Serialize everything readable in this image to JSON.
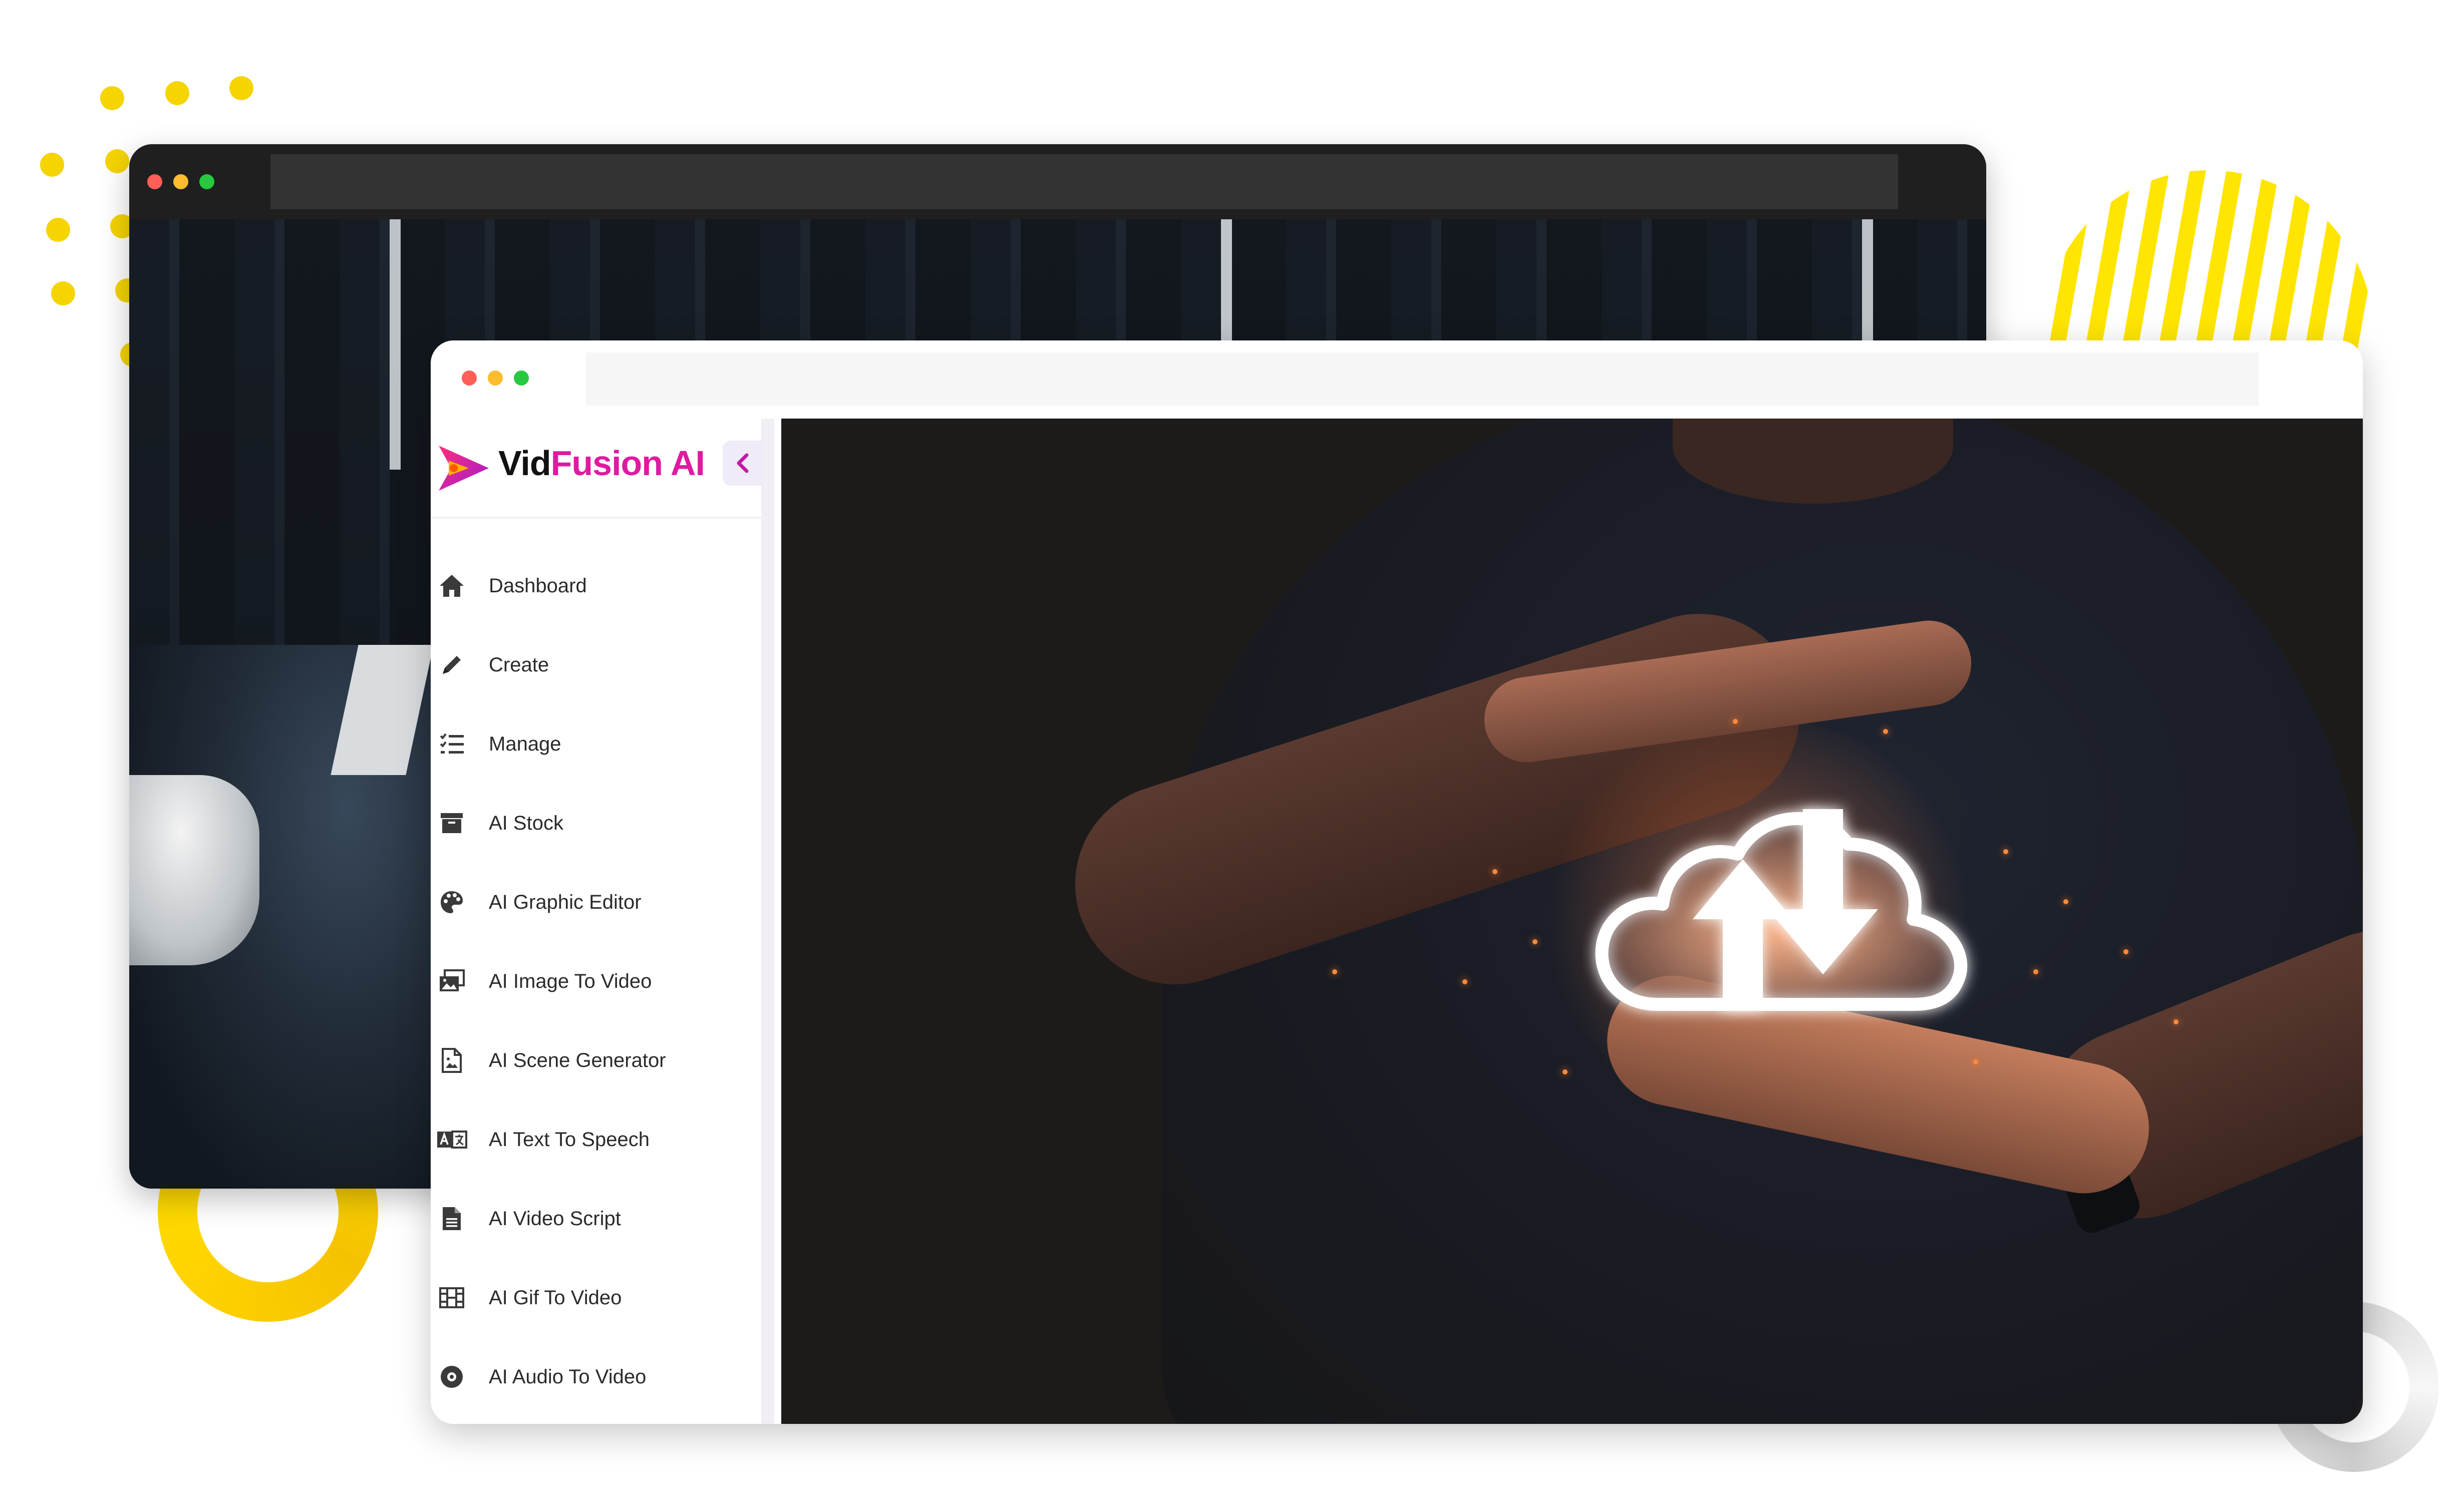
{
  "brand": {
    "part1": "Vid",
    "part2": "Fusion AI",
    "accent": "#e01aa0"
  },
  "sidebar": {
    "collapse_icon": "chevron-left-icon",
    "items": [
      {
        "label": "Dashboard",
        "icon": "home-icon"
      },
      {
        "label": "Create",
        "icon": "pencil-icon"
      },
      {
        "label": "Manage",
        "icon": "checklist-icon"
      },
      {
        "label": "AI Stock",
        "icon": "archive-icon"
      },
      {
        "label": "AI Graphic Editor",
        "icon": "palette-icon"
      },
      {
        "label": "AI Image To Video",
        "icon": "images-icon"
      },
      {
        "label": "AI Scene Generator",
        "icon": "file-image-icon"
      },
      {
        "label": "AI Text To Speech",
        "icon": "language-icon"
      },
      {
        "label": "AI Video Script",
        "icon": "file-text-icon"
      },
      {
        "label": "AI Gif To Video",
        "icon": "film-icon"
      },
      {
        "label": "AI Audio To Video",
        "icon": "compact-disc-icon"
      }
    ]
  },
  "colors": {
    "window_dot_red": "#ff5f57",
    "window_dot_yellow": "#febc2e",
    "window_dot_green": "#28c840",
    "decor_yellow": "#f5d400"
  }
}
